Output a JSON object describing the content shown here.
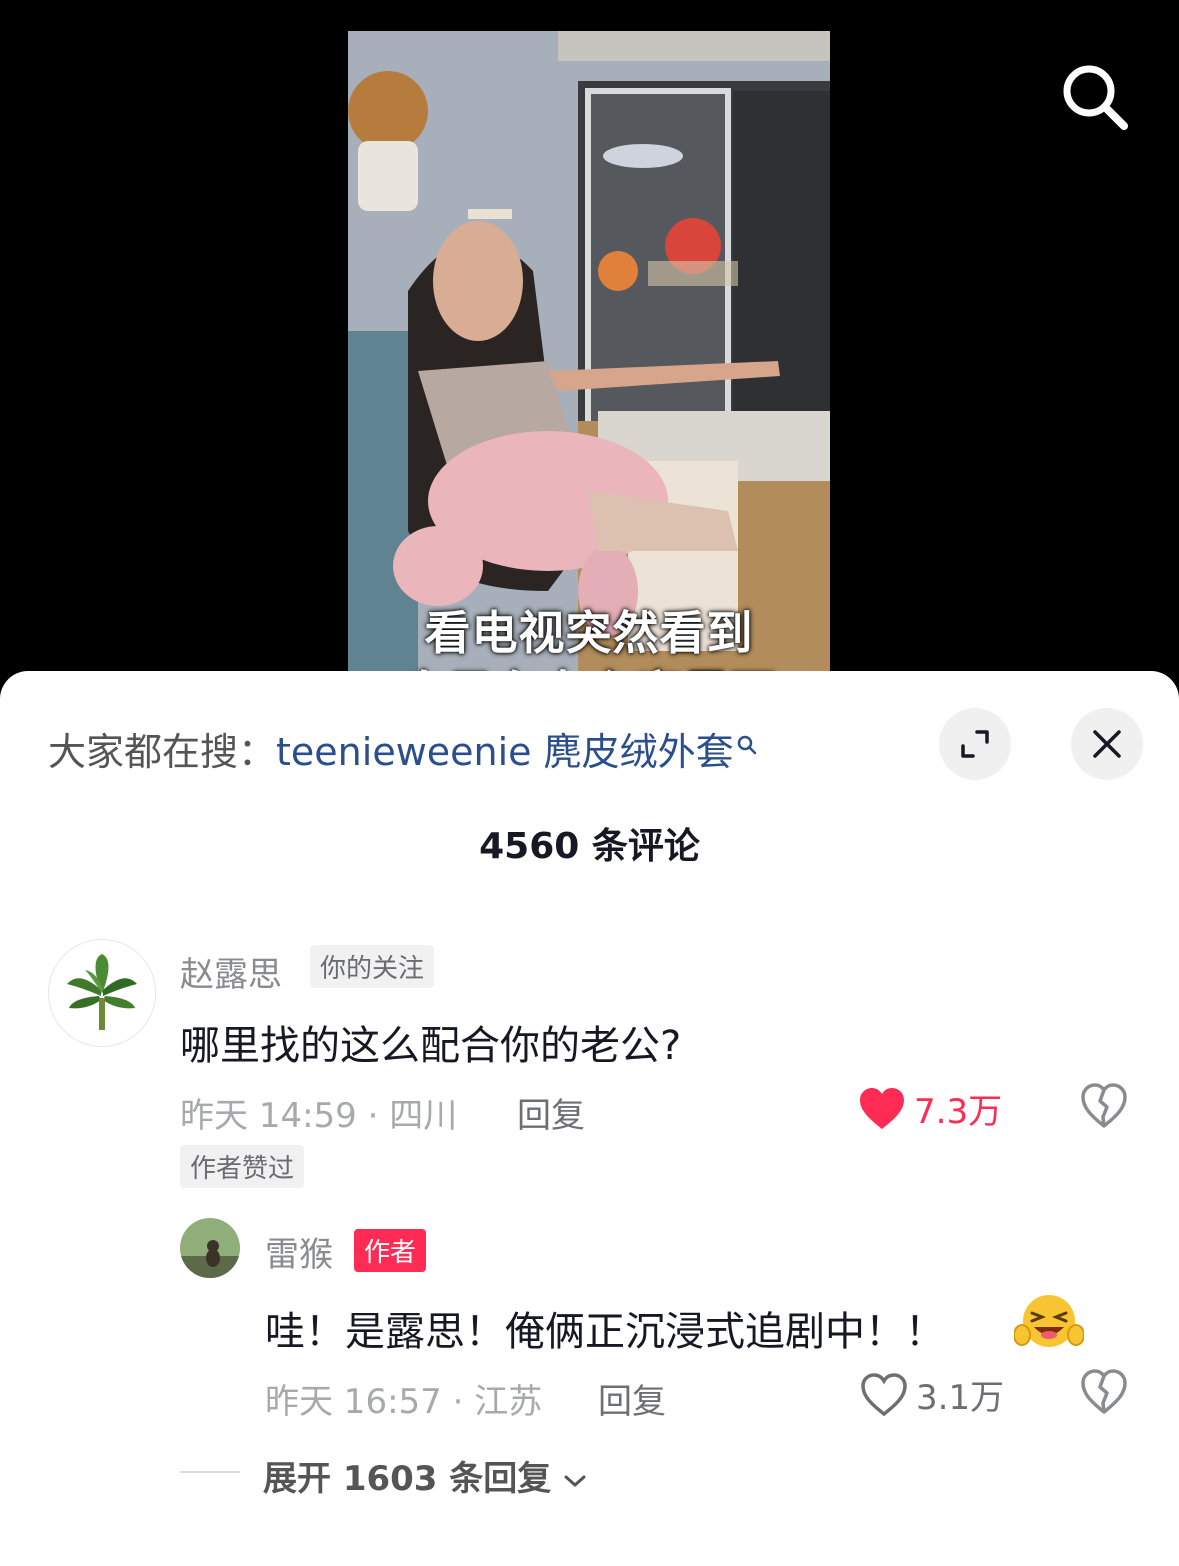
{
  "video": {
    "caption_line1": "看电视突然看到",
    "caption_line2": "自己在女主家里面"
  },
  "header": {
    "search_icon": "search-icon"
  },
  "comment_panel": {
    "hot_search_label": "大家都在搜：",
    "hot_search_keyword": "teenieweenie 麂皮绒外套",
    "comment_count": "4560 条评论",
    "expand_icon": "expand-icon",
    "close_icon": "close-icon",
    "comments": [
      {
        "username": "赵露思",
        "badge": "你的关注",
        "text": "哪里找的这么配合你的老公?",
        "time_location": "昨天 14:59 · 四川",
        "reply_label": "回复",
        "likes": "7.3万",
        "liked": true,
        "author_liked_tag": "作者赞过",
        "reply": {
          "username": "雷猴",
          "badge": "作者",
          "text": "哇！是露思！俺俩正沉浸式追剧中！！",
          "emoji": "grinning-squint-emoji",
          "time_location": "昨天 16:57 · 江苏",
          "reply_label": "回复",
          "likes": "3.1万",
          "liked": false
        }
      }
    ],
    "expand_replies": "展开 1603 条回复"
  },
  "colors": {
    "like_active": "#fe2c55",
    "author_badge": "#fe2c55",
    "keyword": "#2b4f8c"
  }
}
